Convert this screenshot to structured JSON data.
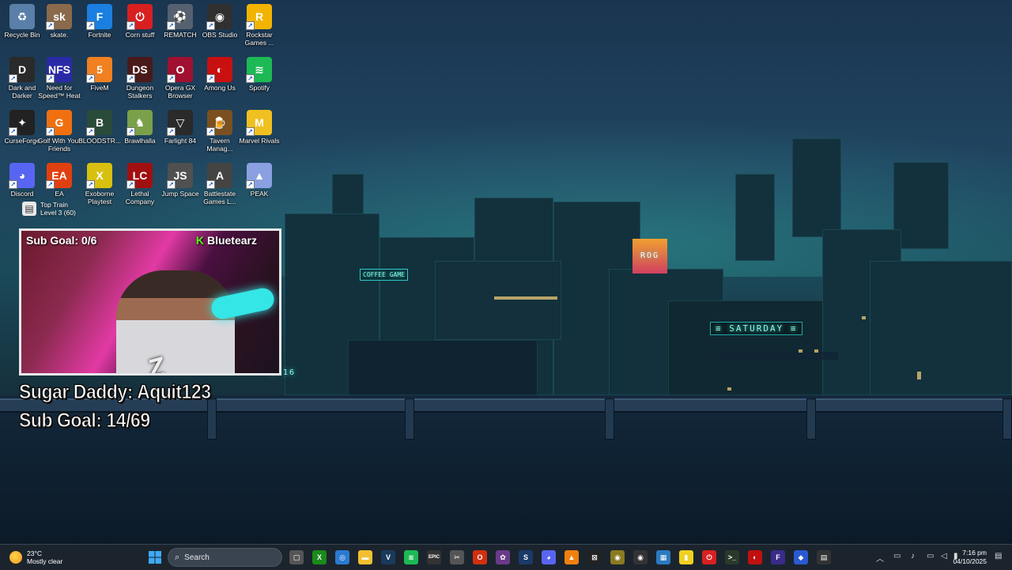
{
  "desktop_icons": [
    {
      "label": "Recycle Bin",
      "glyph": "♻",
      "color": "#5a7fa8"
    },
    {
      "label": "skate.",
      "glyph": "sk",
      "color": "#8a6a4a"
    },
    {
      "label": "Fortnite",
      "glyph": "F",
      "color": "#1a7fe0"
    },
    {
      "label": "Corn stuff",
      "glyph": "⏻",
      "color": "#d82020"
    },
    {
      "label": "REMATCH",
      "glyph": "⚽",
      "color": "#556070"
    },
    {
      "label": "OBS Studio",
      "glyph": "◉",
      "color": "#303030"
    },
    {
      "label": "Rockstar Games ...",
      "glyph": "R",
      "color": "#f2b400"
    },
    {
      "label": "Dark and Darker",
      "glyph": "D",
      "color": "#2a2a2a"
    },
    {
      "label": "Need for Speed™ Heat",
      "glyph": "NFS",
      "color": "#2a2aa8"
    },
    {
      "label": "FiveM",
      "glyph": "5",
      "color": "#f08020"
    },
    {
      "label": "Dungeon Stalkers",
      "glyph": "DS",
      "color": "#4a1a1a"
    },
    {
      "label": "Opera GX Browser",
      "glyph": "O",
      "color": "#a01030"
    },
    {
      "label": "Among Us",
      "glyph": "◐",
      "color": "#c81010"
    },
    {
      "label": "Spotify",
      "glyph": "≋",
      "color": "#1db954"
    },
    {
      "label": "CurseForge",
      "glyph": "✦",
      "color": "#222"
    },
    {
      "label": "Golf With Your Friends",
      "glyph": "G",
      "color": "#f07010"
    },
    {
      "label": "BLOODSTR...",
      "glyph": "B",
      "color": "#2a4a3a"
    },
    {
      "label": "Brawlhalla",
      "glyph": "♞",
      "color": "#7aa04a"
    },
    {
      "label": "Farlight 84",
      "glyph": "▽",
      "color": "#2a2a2a"
    },
    {
      "label": "Tavern Manag...",
      "glyph": "🍺",
      "color": "#7a5020"
    },
    {
      "label": "Marvel Rivals",
      "glyph": "M",
      "color": "#f0c020"
    },
    {
      "label": "Discord",
      "glyph": "◕",
      "color": "#5865f2"
    },
    {
      "label": "EA",
      "glyph": "EA",
      "color": "#e04010"
    },
    {
      "label": "Exoborne Playtest",
      "glyph": "X",
      "color": "#d8c010"
    },
    {
      "label": "Lethal Company",
      "glyph": "LC",
      "color": "#a01010"
    },
    {
      "label": "Jump Space",
      "glyph": "JS",
      "color": "#505050"
    },
    {
      "label": "Battlestate Games L...",
      "glyph": "A",
      "color": "#444"
    },
    {
      "label": "PEAK",
      "glyph": "▲",
      "color": "#8aa0e0"
    }
  ],
  "train_icon": {
    "label_line1": "Top Train",
    "label_line2": "Level 3 (60)"
  },
  "stream": {
    "cam_subgoal": "Sub Goal: 0/6",
    "kick_name": "Bluetearz",
    "kick_glyph": "K",
    "cam_logo": "Z",
    "sugar_daddy": "Sugar Daddy: Aquit123",
    "sub_goal_big": "Sub Goal: 14/69"
  },
  "wallpaper": {
    "sign_saturday": "≡ SATURDAY ≡",
    "sign_coffee": "COFFEE GAME",
    "sign_rog": "ROG",
    "sign_time": "1:16"
  },
  "taskbar": {
    "weather_temp": "23°C",
    "weather_desc": "Mostly clear",
    "start_icon": "windows-start-icon",
    "search_placeholder": "Search",
    "apps": [
      {
        "name": "task-view",
        "glyph": "▢",
        "color": "#555"
      },
      {
        "name": "xbox",
        "glyph": "X",
        "color": "#1a8a1a"
      },
      {
        "name": "chrome",
        "glyph": "◎",
        "color": "#2a7ad0"
      },
      {
        "name": "file-explorer",
        "glyph": "▬",
        "color": "#f0c030"
      },
      {
        "name": "visual-studio",
        "glyph": "V",
        "color": "#1a3a5a"
      },
      {
        "name": "spotify",
        "glyph": "≋",
        "color": "#1db954"
      },
      {
        "name": "epic-games",
        "glyph": "EPIC",
        "color": "#333"
      },
      {
        "name": "snipping-tool",
        "glyph": "✂",
        "color": "#555"
      },
      {
        "name": "opera-gx",
        "glyph": "O",
        "color": "#d03010"
      },
      {
        "name": "app-swirl",
        "glyph": "✿",
        "color": "#6a3a8a"
      },
      {
        "name": "steam",
        "glyph": "S",
        "color": "#1a3a6a"
      },
      {
        "name": "discord",
        "glyph": "◕",
        "color": "#5865f2"
      },
      {
        "name": "vlc",
        "glyph": "▲",
        "color": "#f08010"
      },
      {
        "name": "capcut",
        "glyph": "⊠",
        "color": "#222"
      },
      {
        "name": "app-gold",
        "glyph": "◉",
        "color": "#8a7a20"
      },
      {
        "name": "obs",
        "glyph": "◉",
        "color": "#333"
      },
      {
        "name": "photos",
        "glyph": "▦",
        "color": "#2a7ac0"
      },
      {
        "name": "sticky-notes",
        "glyph": "▮",
        "color": "#f0d020"
      },
      {
        "name": "corn-stuff",
        "glyph": "⏻",
        "color": "#d82020"
      },
      {
        "name": "terminal",
        "glyph": ">_",
        "color": "#2a3a2a"
      },
      {
        "name": "app-red-circle",
        "glyph": "◐",
        "color": "#c01010"
      },
      {
        "name": "fortnite",
        "glyph": "F",
        "color": "#3a2a8a"
      },
      {
        "name": "app-blue-diamond",
        "glyph": "◆",
        "color": "#2a5ad0"
      },
      {
        "name": "app-grid",
        "glyph": "▤",
        "color": "#333"
      }
    ],
    "time": "7:16 pm",
    "date": "04/10/2025"
  }
}
